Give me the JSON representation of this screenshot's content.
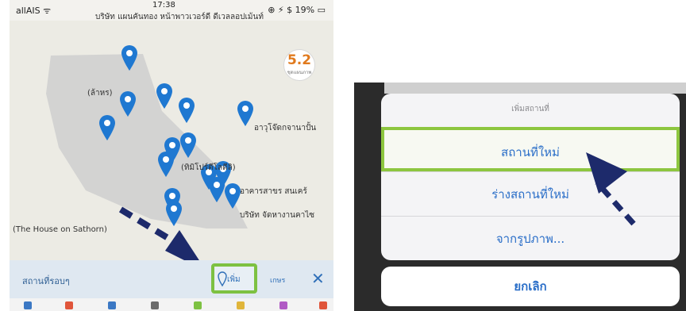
{
  "left_phone": {
    "status_left": "allAIS ᯤ",
    "status_time": "17:38",
    "status_right": "⊕ ⚡ $ 19% ▭",
    "banner_text": "บริษัท แผนคันทอง หน้าพาวเวอร์ดี ดีเวลลอปเม้นท์",
    "zoom_value": "5.2",
    "zoom_unit": "ชุดแผนภาพ",
    "map_labels": {
      "a": "(ล้าหร)",
      "b": "อาวุโจ๊ดกจานาปั้น",
      "c": "(ทิมิโปร์ตีโลดีลิ)",
      "d": "อาคารสาขร สนเคร้",
      "e": "บริษัท จัดหางานคาไซ",
      "f": "(The House on Sathorn)"
    },
    "bottom_bar": {
      "nearby_label": "สถานที่รอบๆ",
      "add_label": "เพิ่ม",
      "sync_label": "เกษร",
      "close_label": "✕"
    }
  },
  "right_phone": {
    "sheet_title": "เพิ่มสถานที่",
    "option_new_place": "สถานที่ใหม่",
    "option_draft_place": "ร่างสถานที่ใหม่",
    "option_from_photo": "จากรูปภาพ...",
    "cancel_label": "ยกเลิก"
  },
  "colors": {
    "highlight_green": "#8dc63f",
    "arrow_navy": "#1d2a6b",
    "link_blue": "#2a6ec8",
    "pin_blue": "#1f78d1"
  }
}
